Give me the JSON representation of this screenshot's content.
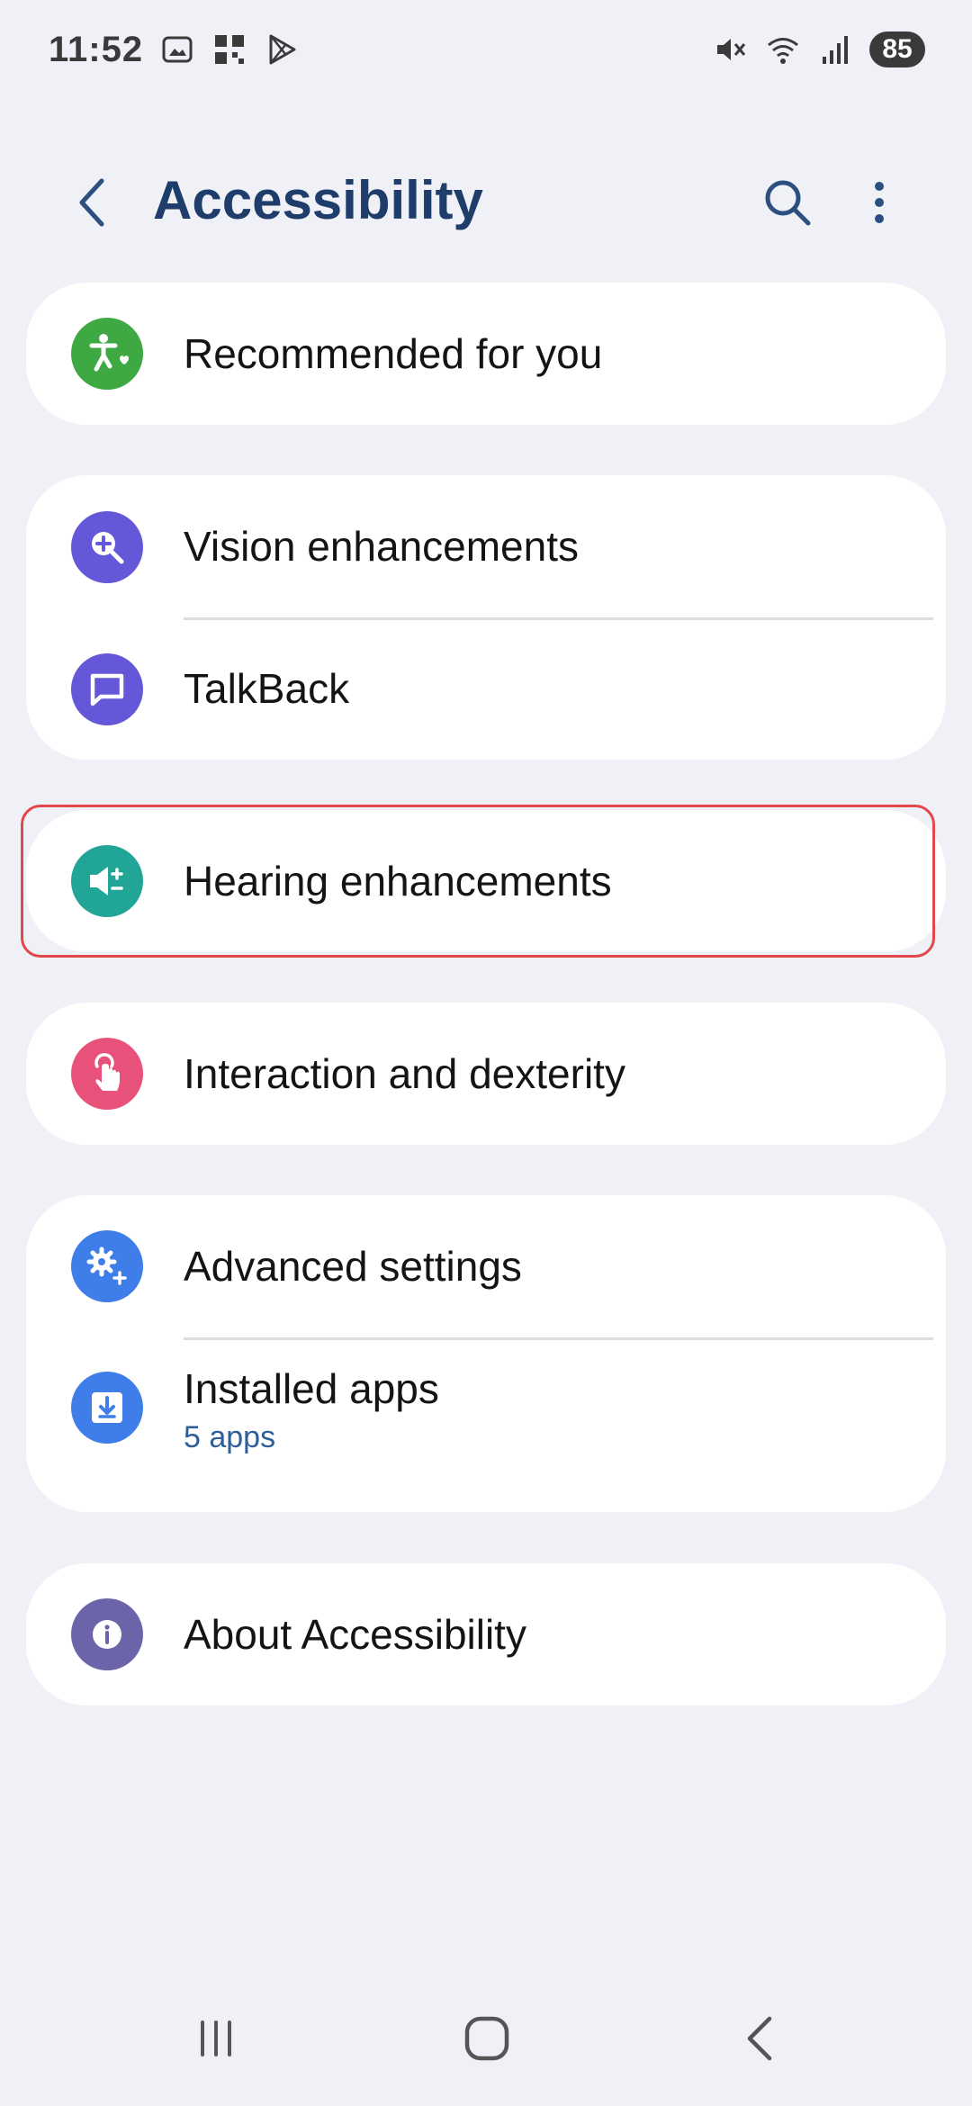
{
  "status_bar": {
    "time": "11:52",
    "battery": "85",
    "left_icons": [
      "screenshot-icon",
      "qr-icon",
      "play-store-icon"
    ],
    "right_icons": [
      "mute-icon",
      "wifi-icon",
      "signal-icon"
    ]
  },
  "header": {
    "title": "Accessibility",
    "back_icon": "back-icon",
    "search_icon": "search-icon",
    "more_icon": "more-options-icon"
  },
  "groups": [
    {
      "items": [
        {
          "label": "Recommended for you",
          "icon": "accessibility-person-icon",
          "color": "#3ea843"
        }
      ]
    },
    {
      "items": [
        {
          "label": "Vision enhancements",
          "icon": "magnifier-plus-icon",
          "color": "#6457d8"
        },
        {
          "label": "TalkBack",
          "icon": "chat-bubble-icon",
          "color": "#6457d8"
        }
      ]
    },
    {
      "items": [
        {
          "label": "Hearing enhancements",
          "icon": "speaker-plus-minus-icon",
          "color": "#20a596"
        }
      ]
    },
    {
      "items": [
        {
          "label": "Interaction and dexterity",
          "icon": "touch-hand-icon",
          "color": "#e8517a"
        }
      ]
    },
    {
      "items": [
        {
          "label": "Advanced settings",
          "icon": "gears-plus-icon",
          "color": "#3f7de8"
        },
        {
          "label": "Installed apps",
          "sublabel": "5 apps",
          "icon": "download-box-icon",
          "color": "#3f7de8"
        }
      ]
    },
    {
      "items": [
        {
          "label": "About Accessibility",
          "icon": "info-icon",
          "color": "#6b64a8"
        }
      ]
    }
  ],
  "nav_bar": {
    "recents_icon": "recents-icon",
    "home_icon": "home-icon",
    "back_icon": "nav-back-icon"
  },
  "colors": {
    "background": "#f0f1f6",
    "card": "#ffffff",
    "title": "#1e3d6b",
    "sublabel": "#2f5f99",
    "highlight": "#e2474b"
  }
}
